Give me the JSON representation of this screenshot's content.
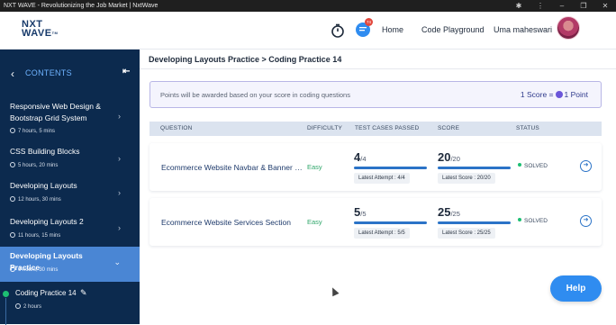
{
  "window": {
    "title": "NXT WAVE - Revolutionizing the Job Market | NxtWave",
    "controls": [
      "puzzle",
      "menu",
      "minimize",
      "maximize",
      "close"
    ]
  },
  "header": {
    "logo_main": "NXT",
    "logo_sub": "WAVE",
    "logo_tm": "TM",
    "chat_badge": "74",
    "nav": {
      "home": "Home",
      "playground": "Code Playground",
      "user": "Uma maheswari"
    }
  },
  "sidebar": {
    "title": "CONTENTS",
    "items": [
      {
        "name": "Responsive Web Design & Bootstrap Grid System",
        "time": "7 hours, 5 mins"
      },
      {
        "name": "CSS Building Blocks",
        "time": "5 hours, 20 mins"
      },
      {
        "name": "Developing Layouts",
        "time": "12 hours, 30 mins"
      },
      {
        "name": "Developing Layouts 2",
        "time": "11 hours, 15 mins"
      },
      {
        "name": "Developing Layouts Practice",
        "time": "6 hours, 30 mins"
      }
    ],
    "sub_item": {
      "name": "Coding Practice 14",
      "time": "2 hours"
    }
  },
  "main": {
    "breadcrumb": "Developing Layouts Practice > Coding Practice 14",
    "info": {
      "message": "Points will be awarded based on your score in coding questions",
      "score_text": "1 Score =",
      "point_text": "1 Point"
    },
    "columns": [
      "QUESTION",
      "DIFFICULTY",
      "TEST CASES PASSED",
      "SCORE",
      "STATUS"
    ],
    "rows": [
      {
        "question": "Ecommerce Website Navbar & Banner Section",
        "difficulty": "Easy",
        "passed": "4",
        "total": "/4",
        "latest_attempt": "Latest Attempt : 4/4",
        "score": "20",
        "score_total": "/20",
        "latest_score": "Latest Score : 20/20",
        "status": "SOLVED"
      },
      {
        "question": "Ecommerce Website Services Section",
        "difficulty": "Easy",
        "passed": "5",
        "total": "/5",
        "latest_attempt": "Latest Attempt : 5/5",
        "score": "25",
        "score_total": "/25",
        "latest_score": "Latest Score : 25/25",
        "status": "SOLVED"
      }
    ]
  },
  "help": {
    "label": "Help"
  },
  "colors": {
    "sidebar": "#0c2a4e",
    "active": "#4a86d4",
    "accent": "#2b73c7",
    "success": "#1dbf73"
  }
}
